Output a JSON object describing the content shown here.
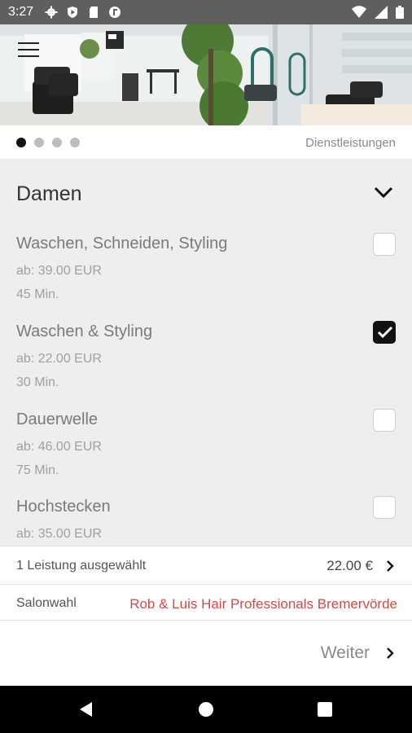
{
  "status_bar": {
    "time": "3:27",
    "icons": [
      "gear-icon",
      "play-protect-icon",
      "sd-card-icon",
      "app-notification-icon"
    ],
    "right_icons": [
      "wifi-icon",
      "signal-icon",
      "battery-icon"
    ]
  },
  "hero": {
    "image": "salon-interior-photo",
    "menu_icon": "hamburger-menu-icon"
  },
  "pager": {
    "dots": 4,
    "active_dot": 1,
    "label": "Dienstleistungen"
  },
  "category": {
    "title": "Damen",
    "expanded": true
  },
  "services": [
    {
      "name": "Waschen, Schneiden, Styling",
      "price": "ab: 39.00 EUR",
      "duration": "45 Min.",
      "checked": false
    },
    {
      "name": "Waschen & Styling",
      "price": "ab: 22.00 EUR",
      "duration": "30 Min.",
      "checked": true
    },
    {
      "name": "Dauerwelle",
      "price": "ab: 46.00 EUR",
      "duration": "75 Min.",
      "checked": false
    },
    {
      "name": "Hochstecken",
      "price": "ab: 35.00 EUR",
      "duration": "",
      "checked": false
    }
  ],
  "summary": {
    "label": "1 Leistung ausgewählt",
    "total": "22.00 €"
  },
  "salon": {
    "label": "Salonwahl",
    "value": "Rob & Luis Hair Professionals Bremervörde"
  },
  "footer": {
    "next_label": "Weiter"
  },
  "colors": {
    "accent_red": "#d04a4a",
    "status_bar": "#5f5f5f",
    "list_bg": "#eeeeee",
    "checked": "#111111"
  }
}
